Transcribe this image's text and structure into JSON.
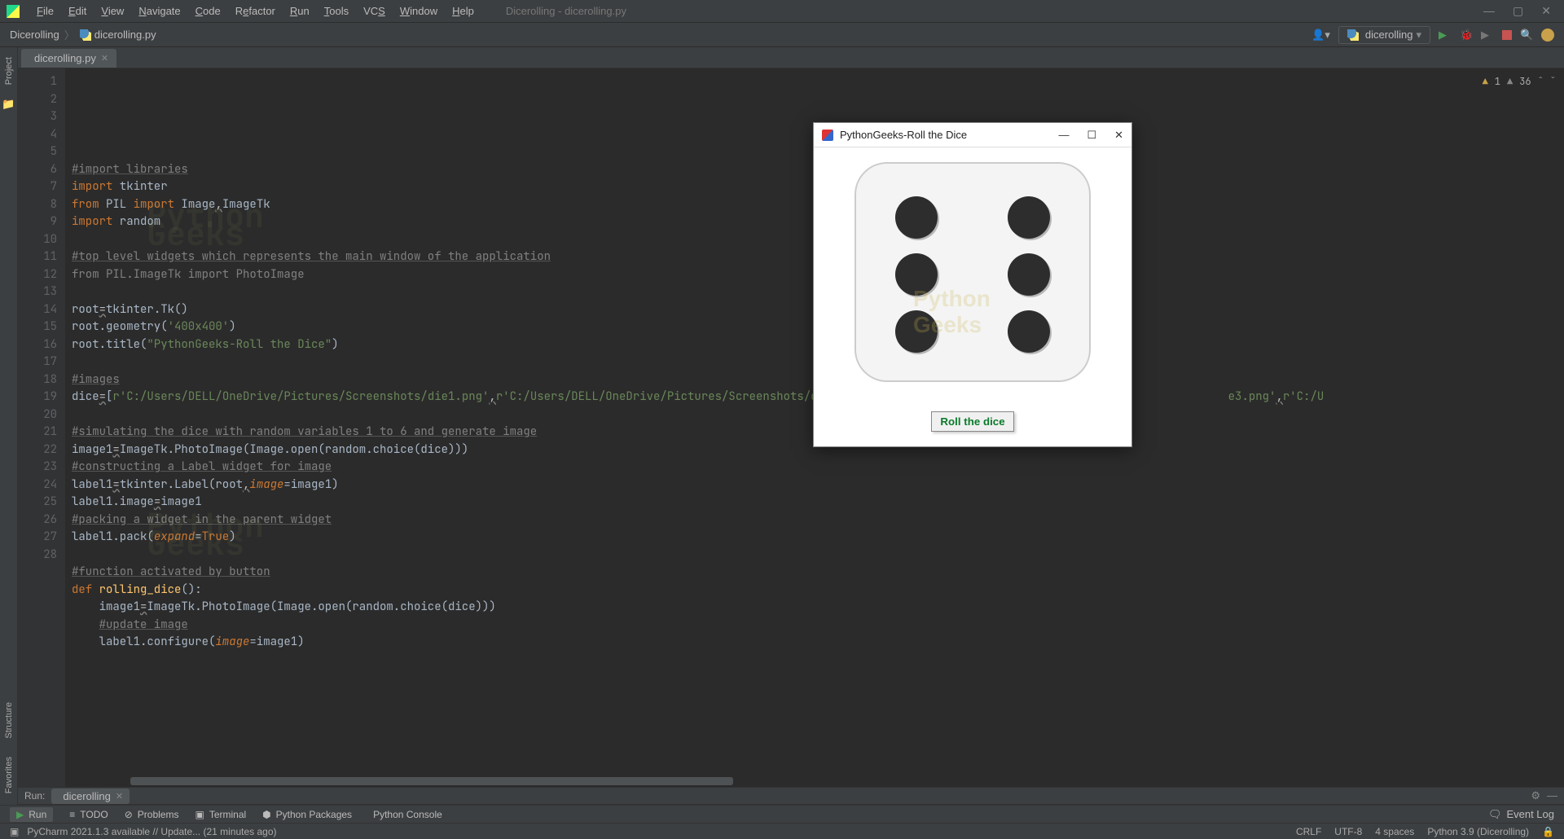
{
  "menu": [
    "File",
    "Edit",
    "View",
    "Navigate",
    "Code",
    "Refactor",
    "Run",
    "Tools",
    "VCS",
    "Window",
    "Help"
  ],
  "menu_underline_idx": [
    0,
    0,
    0,
    0,
    0,
    1,
    0,
    0,
    2,
    0,
    0
  ],
  "window_title": "Dicerolling - dicerolling.py",
  "breadcrumb": {
    "project": "Dicerolling",
    "file": "dicerolling.py"
  },
  "run_config": "dicerolling",
  "tab": {
    "name": "dicerolling.py"
  },
  "left_tools": [
    "Project",
    "Structure",
    "Favorites"
  ],
  "inspections": {
    "warnings": 1,
    "weak_warnings": 36
  },
  "code_lines": [
    {
      "n": 1,
      "html": "<span class='c-comment'>#import libraries</span>"
    },
    {
      "n": 2,
      "html": "<span class='c-kw'>import</span> tkinter"
    },
    {
      "n": 3,
      "html": "<span class='c-kw'>from</span> PIL <span class='c-kw'>import</span> Image<span class='c-warn'>,</span>ImageTk"
    },
    {
      "n": 4,
      "html": "<span class='c-kw'>import</span> random"
    },
    {
      "n": 5,
      "html": ""
    },
    {
      "n": 6,
      "html": "<span class='c-comment'>#top level widgets which represents the main window of the application</span>"
    },
    {
      "n": 7,
      "html": "<span style='color:#808080'>from PIL.ImageTk import PhotoImage</span>"
    },
    {
      "n": 8,
      "html": ""
    },
    {
      "n": 9,
      "html": "root<span class='c-warn'>=</span>tkinter.Tk()"
    },
    {
      "n": 10,
      "html": "root.geometry(<span class='c-str'>'400x400'</span>)"
    },
    {
      "n": 11,
      "html": "root.title(<span class='c-str'>\"PythonGeeks-Roll the Dice\"</span>)"
    },
    {
      "n": 12,
      "html": ""
    },
    {
      "n": 13,
      "html": "<span class='c-comment'>#images</span>"
    },
    {
      "n": 14,
      "html": "dice<span class='c-warn'>=</span>[<span class='c-str'>r'C:/Users/DELL/OneDrive/Pictures/Screenshots/die1.png'</span><span class='c-warn'>,</span><span class='c-str'>r'C:/Users/DELL/OneDrive/Pictures/Screenshots/die2.png</span>                                                     <span class='c-str'>e3.png'</span><span class='c-warn'>,</span><span class='c-str'>r'C:/U</span>"
    },
    {
      "n": 15,
      "html": ""
    },
    {
      "n": 16,
      "html": "<span class='c-comment'>#simulating the dice with random variables 1 to 6 and generate image</span>"
    },
    {
      "n": 17,
      "html": "image1<span class='c-warn'>=</span>ImageTk.PhotoImage(Image.open(random.choice(dice)))"
    },
    {
      "n": 18,
      "html": "<span class='c-comment'>#constructing a Label widget for image</span>"
    },
    {
      "n": 19,
      "html": "label1<span class='c-warn'>=</span>tkinter.Label(root<span class='c-warn'>,</span><span class='c-param'>image</span>=image1)"
    },
    {
      "n": 20,
      "html": "label1.image<span class='c-warn'>=</span>image1"
    },
    {
      "n": 21,
      "html": "<span class='c-comment'>#packing a widget in the parent widget</span>"
    },
    {
      "n": 22,
      "html": "label1.pack(<span class='c-param'>expand</span>=<span class='c-kw'>True</span>)"
    },
    {
      "n": 23,
      "html": ""
    },
    {
      "n": 24,
      "html": "<span class='c-comment'>#function activated by button</span>"
    },
    {
      "n": 25,
      "html": "<span class='c-kw'>def</span> <span class='c-fn'>rolling_dice</span>():"
    },
    {
      "n": 26,
      "html": "    image1<span class='c-warn'>=</span>ImageTk.PhotoImage(Image.open(random.choice(dice)))"
    },
    {
      "n": 27,
      "html": "    <span class='c-comment'>#update image</span>"
    },
    {
      "n": 28,
      "html": "    label1.configure(<span class='c-param'>image</span>=image1)"
    }
  ],
  "run_panel": {
    "title": "Run:",
    "tab": "dicerolling"
  },
  "bottom_tools": [
    "Run",
    "TODO",
    "Problems",
    "Terminal",
    "Python Packages",
    "Python Console"
  ],
  "event_log": "Event Log",
  "status": {
    "left": "PyCharm 2021.1.3 available // Update... (21 minutes ago)",
    "right": [
      "CRLF",
      "UTF-8",
      "4 spaces",
      "Python 3.9 (Dicerolling)"
    ]
  },
  "tk_window": {
    "title": "PythonGeeks-Roll the Dice",
    "button": "Roll the dice",
    "pips": 6
  }
}
